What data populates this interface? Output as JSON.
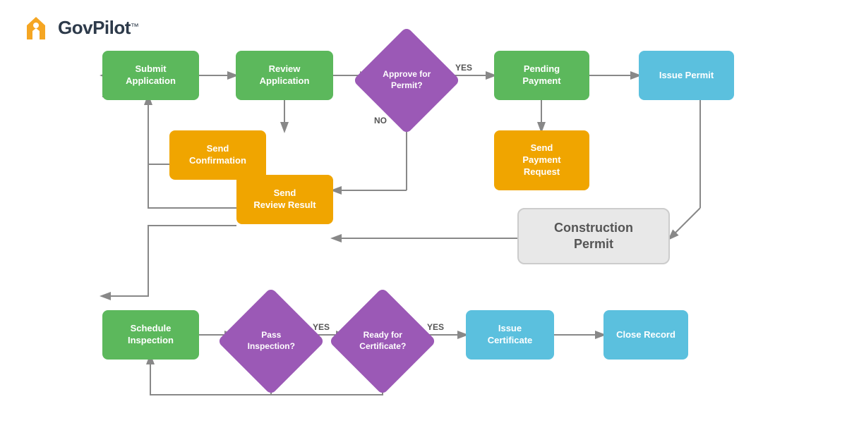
{
  "header": {
    "logo_alt": "GovPilot logo",
    "brand_name": "GovPilot",
    "tm": "™"
  },
  "nodes": {
    "submit_application": "Submit\nApplication",
    "review_application": "Review\nApplication",
    "approve_for_permit": "Approve\nfor Permit?",
    "pending_payment": "Pending\nPayment",
    "issue_permit": "Issue Permit",
    "send_confirmation": "Send\nConfirmation",
    "send_payment_request": "Send\nPayment\nRequest",
    "send_review_result": "Send\nReview Result",
    "construction_permit": "Construction\nPermit",
    "schedule_inspection": "Schedule\nInspection",
    "pass_inspection": "Pass\nInspection?",
    "ready_for_certificate": "Ready for\nCertificate?",
    "issue_certificate": "Issue\nCertificate",
    "close_record": "Close Record"
  },
  "labels": {
    "yes": "YES",
    "no": "NO"
  },
  "colors": {
    "green": "#5cb85c",
    "orange": "#f0a500",
    "blue": "#5bc0de",
    "purple": "#9b59b6",
    "gray_bg": "#e8e8e8",
    "gray_border": "#ccc",
    "arrow": "#888",
    "text_dark": "#2d3a4a",
    "logo_gold": "#f5a623"
  }
}
